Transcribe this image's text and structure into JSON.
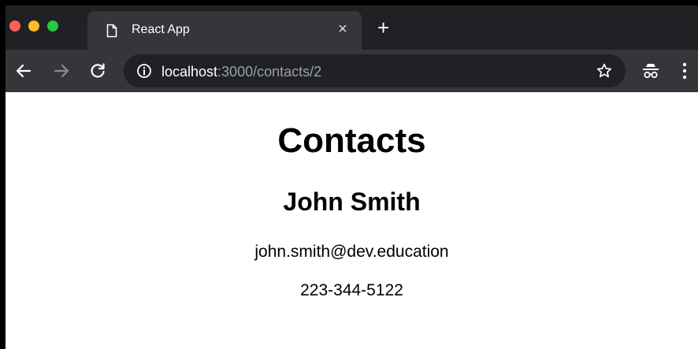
{
  "browser": {
    "tab": {
      "title": "React App",
      "icon": "page-icon",
      "close_glyph": "×"
    },
    "new_tab_glyph": "+",
    "address_bar": {
      "host": "localhost",
      "path": ":3000/contacts/2"
    },
    "toolbar_icons": [
      "back-arrow-icon",
      "forward-arrow-icon",
      "reload-icon",
      "info-icon",
      "star-icon",
      "incognito-icon",
      "kebab-menu-icon"
    ]
  },
  "page": {
    "heading": "Contacts",
    "contact": {
      "name": "John Smith",
      "email": "john.smith@dev.education",
      "phone": "223-344-5122"
    }
  },
  "colors": {
    "titlebar": "#202124",
    "toolbar": "#35363a",
    "omnibox": "#202124",
    "traffic_red": "#ff5f57",
    "traffic_yellow": "#febc2e",
    "traffic_green": "#28c840"
  }
}
